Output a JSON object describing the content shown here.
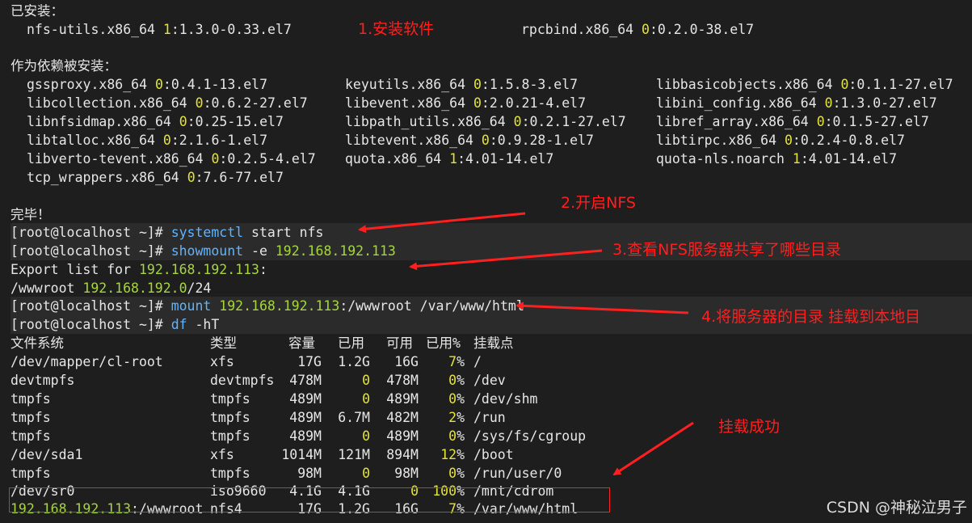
{
  "install": {
    "header": "已安装：",
    "packages": [
      {
        "name": "nfs-utils.x86_64 ",
        "epoch": "1",
        "version": ":1.3.0-0.33.el7"
      },
      {
        "name": "rpcbind.x86_64 ",
        "epoch": "0",
        "version": ":0.2.0-38.el7"
      }
    ]
  },
  "deps": {
    "header": "作为依赖被安装：",
    "packages": [
      {
        "name": "gssproxy.x86_64 ",
        "epoch": "0",
        "version": ":0.4.1-13.el7"
      },
      {
        "name": "keyutils.x86_64 ",
        "epoch": "0",
        "version": ":1.5.8-3.el7"
      },
      {
        "name": "libbasicobjects.x86_64 ",
        "epoch": "0",
        "version": ":0.1.1-27.el7"
      },
      {
        "name": "libcollection.x86_64 ",
        "epoch": "0",
        "version": ":0.6.2-27.el7"
      },
      {
        "name": "libevent.x86_64 ",
        "epoch": "0",
        "version": ":2.0.21-4.el7"
      },
      {
        "name": "libini_config.x86_64 ",
        "epoch": "0",
        "version": ":1.3.0-27.el7"
      },
      {
        "name": "libnfsidmap.x86_64 ",
        "epoch": "0",
        "version": ":0.25-15.el7"
      },
      {
        "name": "libpath_utils.x86_64 ",
        "epoch": "0",
        "version": ":0.2.1-27.el7"
      },
      {
        "name": "libref_array.x86_64 ",
        "epoch": "0",
        "version": ":0.1.5-27.el7"
      },
      {
        "name": "libtalloc.x86_64 ",
        "epoch": "0",
        "version": ":2.1.6-1.el7"
      },
      {
        "name": "libtevent.x86_64 ",
        "epoch": "0",
        "version": ":0.9.28-1.el7"
      },
      {
        "name": "libtirpc.x86_64 ",
        "epoch": "0",
        "version": ":0.2.4-0.8.el7"
      },
      {
        "name": "libverto-tevent.x86_64 ",
        "epoch": "0",
        "version": ":0.2.5-4.el7"
      },
      {
        "name": "quota.x86_64 ",
        "epoch": "1",
        "version": ":4.01-14.el7"
      },
      {
        "name": "quota-nls.noarch ",
        "epoch": "1",
        "version": ":4.01-14.el7"
      },
      {
        "name": "tcp_wrappers.x86_64 ",
        "epoch": "0",
        "version": ":7.6-77.el7"
      }
    ]
  },
  "done": "完毕！",
  "prompt": "[root@localhost ~]# ",
  "cmd1": {
    "prog": "systemctl",
    "rest": " start nfs"
  },
  "cmd2": {
    "prog": "showmount",
    "flag": " -e ",
    "ip": "192.168.192.113"
  },
  "export": {
    "label": "Export list for ",
    "ip": "192.168.192.113",
    "colon": ":"
  },
  "share": {
    "path": "/wwwroot ",
    "net": "192.168.192.0",
    "mask": "/24"
  },
  "cmd3": {
    "prog": "mount",
    "sp": " ",
    "ip": "192.168.192.113",
    "rest": ":/wwwroot /var/www/html"
  },
  "cmd4": {
    "prog": "df",
    "flag": " -hT"
  },
  "df": {
    "headers": [
      "文件系统",
      "类型",
      "容量",
      "已用",
      "可用",
      "已用%",
      "挂载点"
    ],
    "rows": [
      {
        "fs": "/dev/mapper/cl-root",
        "type": "xfs",
        "size": "17G",
        "used": "1.2G",
        "avail": "16G",
        "pct_num": "7",
        "pct": "%",
        "mount": "/"
      },
      {
        "fs": "devtmpfs",
        "type": "devtmpfs",
        "size": "478M",
        "used": "0",
        "avail": "478M",
        "pct_num": "0",
        "pct": "%",
        "mount": "/dev"
      },
      {
        "fs": "tmpfs",
        "type": "tmpfs",
        "size": "489M",
        "used": "0",
        "avail": "489M",
        "pct_num": "0",
        "pct": "%",
        "mount": "/dev/shm"
      },
      {
        "fs": "tmpfs",
        "type": "tmpfs",
        "size": "489M",
        "used": "6.7M",
        "avail": "482M",
        "pct_num": "2",
        "pct": "%",
        "mount": "/run"
      },
      {
        "fs": "tmpfs",
        "type": "tmpfs",
        "size": "489M",
        "used": "0",
        "avail": "489M",
        "pct_num": "0",
        "pct": "%",
        "mount": "/sys/fs/cgroup"
      },
      {
        "fs": "/dev/sda1",
        "type": "xfs",
        "size": "1014M",
        "used": "121M",
        "avail": "894M",
        "pct_num": "12",
        "pct": "%",
        "mount": "/boot"
      },
      {
        "fs": "tmpfs",
        "type": "tmpfs",
        "size": "98M",
        "used": "0",
        "avail": "98M",
        "pct_num": "0",
        "pct": "%",
        "mount": "/run/user/0"
      },
      {
        "fs": "/dev/sr0",
        "type": "iso9660",
        "size": "4.1G",
        "used": "4.1G",
        "avail": "0",
        "pct_num": "100",
        "pct": "%",
        "mount": "/mnt/cdrom"
      },
      {
        "fs": "192.168.192.113",
        "fs_suffix": ":/wwwroot",
        "type": "nfs4",
        "size": "17G",
        "used": "1.2G",
        "avail": "16G",
        "pct_num": "7",
        "pct": "%",
        "mount": "/var/www/html"
      }
    ]
  },
  "annotations": {
    "step1": "1.安装软件",
    "step2": "2.开启NFS",
    "step3": "3.查看NFS服务器共享了哪些目录",
    "step4": "4.将服务器的目录 挂载到本地目",
    "success": "挂载成功"
  },
  "watermark": "CSDN @神秘泣男子",
  "colors": {
    "background": "#1e1e1e",
    "command": "#5fb4ff",
    "highlight": "#a6d63c",
    "digit": "#e3e33a",
    "annotation": "#ff1f1f"
  }
}
